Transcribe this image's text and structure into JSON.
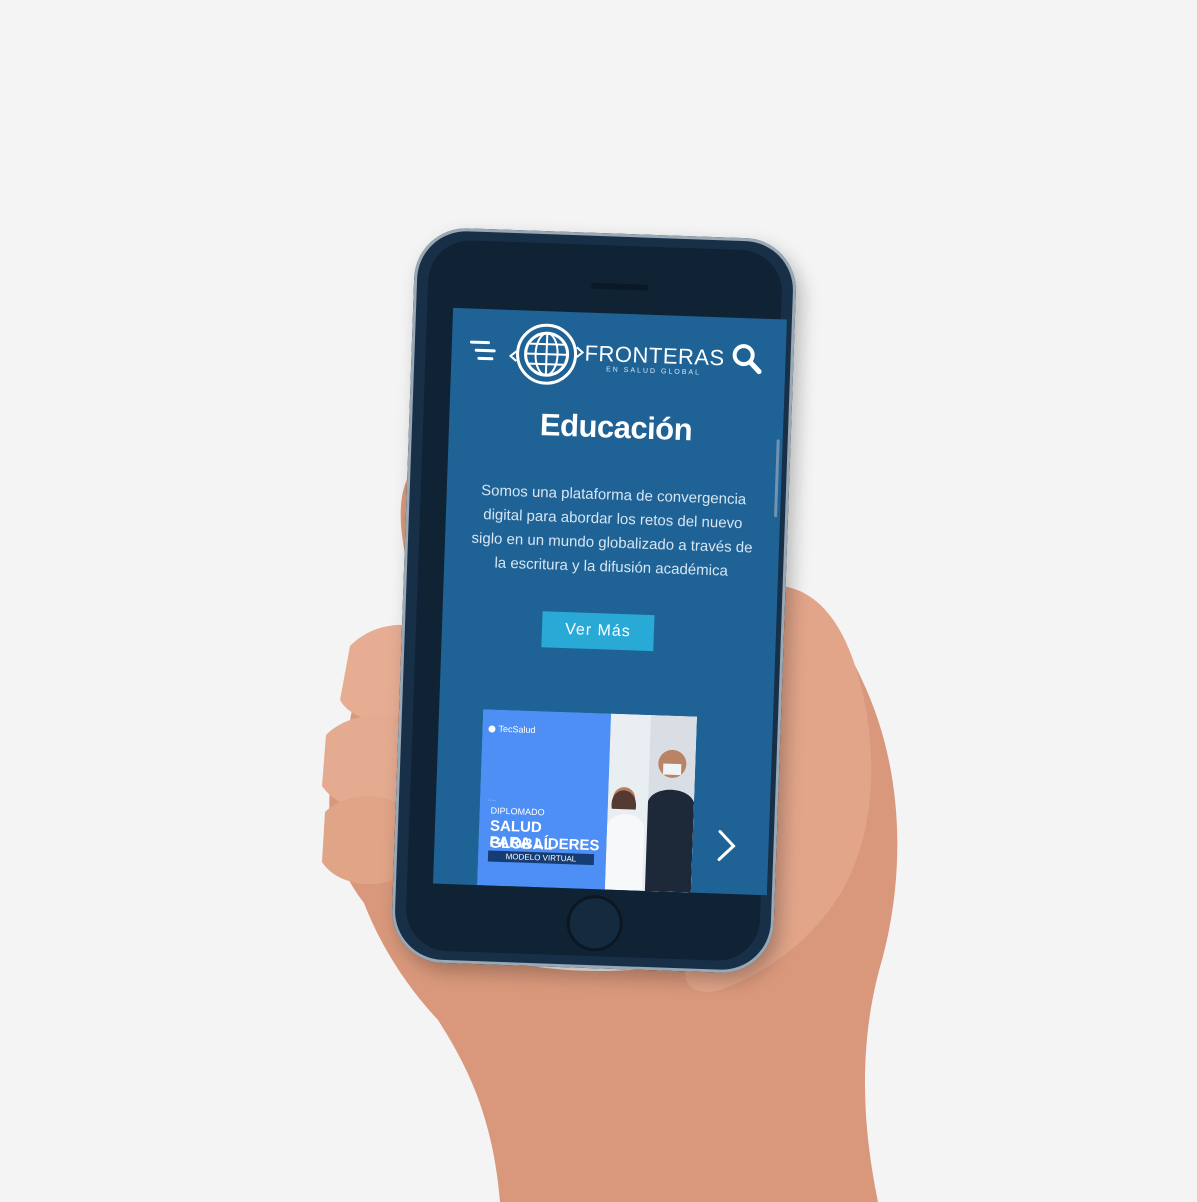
{
  "app": {
    "brand_title": "FRONTERAS",
    "brand_subtitle": "EN SALUD GLOBAL"
  },
  "hero": {
    "title": "Educación",
    "description": "Somos una plataforma de convergencia digital para abordar los retos del nuevo siglo en un mundo globalizado a través de la escritura y la difusión académica",
    "cta_label": "Ver Más"
  },
  "banner": {
    "brand": "TecSalud",
    "kicker": "DIPLOMADO",
    "headline_line1": "SALUD GLOBAL",
    "headline_line2": "PARA LÍDERES",
    "tag": "MODELO VIRTUAL"
  },
  "icons": {
    "menu": "menu-icon",
    "search": "search-icon",
    "next": "chevron-right-icon"
  },
  "colors": {
    "screen_bg": "#1f6396",
    "accent": "#28a9d6",
    "banner_blue": "#4e8ff6"
  }
}
